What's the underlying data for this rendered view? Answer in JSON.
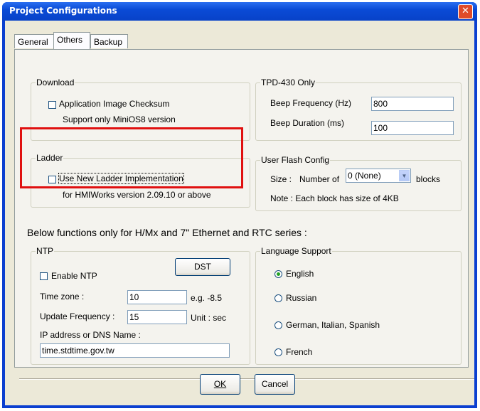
{
  "window": {
    "title": "Project Configurations"
  },
  "tabs": [
    {
      "label": "General",
      "active": false
    },
    {
      "label": "Others",
      "active": true
    },
    {
      "label": "Backup",
      "active": false
    }
  ],
  "download": {
    "legend": "Download",
    "checksum_label": "Application Image Checksum",
    "checksum_checked": false,
    "note": "Support only MiniOS8 version"
  },
  "tpd": {
    "legend": "TPD-430 Only",
    "beep_freq_label": "Beep Frequency (Hz)",
    "beep_freq_value": "800",
    "beep_dur_label": "Beep Duration (ms)",
    "beep_dur_value": "100"
  },
  "ladder": {
    "legend": "Ladder",
    "new_impl_label": "Use New Ladder Implementation",
    "new_impl_checked": false,
    "note": "for HMIWorks version 2.09.10 or above"
  },
  "flash": {
    "legend": "User Flash Config",
    "size_label": "Size :",
    "number_of_label": "Number of",
    "blocks_value": "0 (None)",
    "blocks_label": "blocks",
    "note": "Note : Each block has size of 4KB"
  },
  "section_heading": "Below functions only for H/Mx and 7\" Ethernet and RTC series :",
  "ntp": {
    "legend": "NTP",
    "enable_label": "Enable NTP",
    "enable_checked": false,
    "dst_button": "DST",
    "timezone_label": "Time zone :",
    "timezone_value": "10",
    "timezone_hint": "e.g. -8.5",
    "update_label": "Update Frequency :",
    "update_value": "15",
    "update_unit": "Unit : sec",
    "ip_label": "IP address or DNS Name :",
    "ip_value": "time.stdtime.gov.tw"
  },
  "language": {
    "legend": "Language Support",
    "options": [
      "English",
      "Russian",
      "German, Italian, Spanish",
      "French"
    ],
    "selected": "English"
  },
  "buttons": {
    "ok": "OK",
    "cancel": "Cancel"
  },
  "colors": {
    "highlight_border": "#e01010",
    "titlebar": "#0a4bd6"
  }
}
